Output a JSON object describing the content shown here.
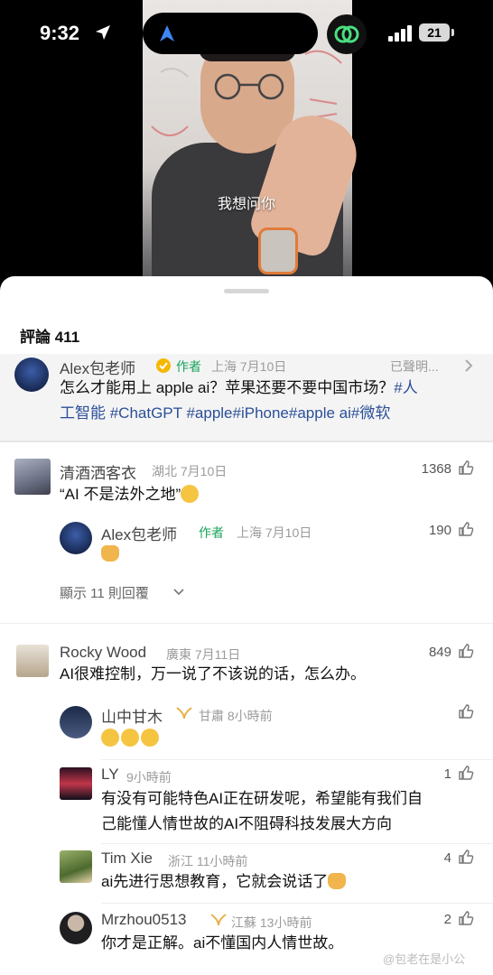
{
  "status_bar": {
    "time": "9:32",
    "battery": "21"
  },
  "video": {
    "subtitle": "我想问你"
  },
  "comments_header": {
    "title": "評論 411"
  },
  "pinned": {
    "author": "Alex包老师",
    "author_tag": "作者",
    "meta": "上海 7月10日",
    "declared": "已聲明...",
    "text_plain": "怎么才能用上 apple ai？苹果还要不要中国市场？",
    "hashtags_line1": "#人",
    "line2": "工智能 #ChatGPT #apple#iPhone#apple ai#微软"
  },
  "comments": [
    {
      "author": "清酒洒客衣",
      "meta": "湖北 7月10日",
      "likes": "1368",
      "text": "“AI 不是法外之地”",
      "replies": [
        {
          "author": "Alex包老师",
          "author_tag": "作者",
          "meta": "上海 7月10日",
          "likes": "190"
        }
      ],
      "show_more": "顯示 11 則回覆"
    },
    {
      "author": "Rocky Wood",
      "meta": "廣東 7月11日",
      "likes": "849",
      "text": "AI很难控制，万一说了不该说的话，怎么办。",
      "replies": [
        {
          "author": "山中甘木",
          "meta": "甘肅 8小時前",
          "likes": ""
        },
        {
          "author": "LY",
          "meta": "9小時前",
          "likes": "1",
          "text_line1": "有没有可能特色AI正在研发呢，希望能有我们自",
          "text_line2": "己能懂人情世故的AI不阻碍科技发展大方向"
        },
        {
          "author": "Tim Xie",
          "meta": "浙江 11小時前",
          "likes": "4",
          "text": "ai先进行思想教育，它就会说话了"
        },
        {
          "author": "Mrzhou0513",
          "meta": "江蘇 13小時前",
          "likes": "2",
          "text": "你才是正解。ai不懂国内人情世故。"
        }
      ]
    }
  ],
  "watermark": "@包老在是小公",
  "colors": {
    "author_green": "#19a35a",
    "hashtag_blue": "#2b4f97"
  }
}
